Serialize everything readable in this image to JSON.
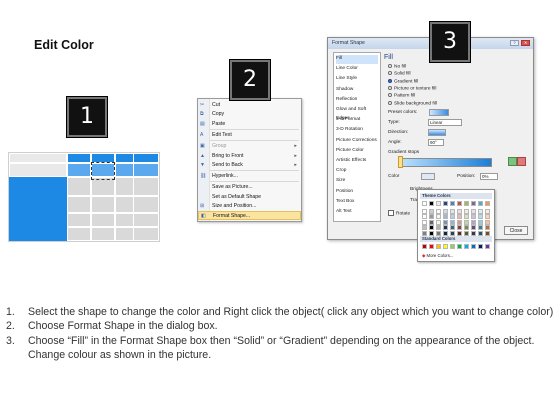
{
  "title": "Edit Color",
  "steps": [
    "1",
    "2",
    "3"
  ],
  "table_shape": {
    "header_color": "#1e88e5",
    "column_color": "#1e88e5",
    "cell_color": "#d9d9d9"
  },
  "context_menu": {
    "items": [
      {
        "label": "Cut",
        "icon": "scissors-icon",
        "disabled": false,
        "arrow": false
      },
      {
        "label": "Copy",
        "icon": "copy-icon",
        "disabled": false,
        "arrow": false
      },
      {
        "label": "Paste",
        "icon": "paste-icon",
        "disabled": false,
        "arrow": false
      },
      {
        "label": "Edit Text",
        "icon": "text-icon",
        "disabled": false,
        "arrow": false
      },
      {
        "label": "Group",
        "icon": "group-icon",
        "disabled": true,
        "arrow": true
      },
      {
        "label": "Bring to Front",
        "icon": "bring-front-icon",
        "disabled": false,
        "arrow": true
      },
      {
        "label": "Send to Back",
        "icon": "send-back-icon",
        "disabled": false,
        "arrow": true
      },
      {
        "label": "Hyperlink...",
        "icon": "link-icon",
        "disabled": false,
        "arrow": false
      },
      {
        "label": "Save as Picture...",
        "icon": "",
        "disabled": false,
        "arrow": false
      },
      {
        "label": "Set as Default Shape",
        "icon": "",
        "disabled": false,
        "arrow": false
      },
      {
        "label": "Size and Position...",
        "icon": "size-icon",
        "disabled": false,
        "arrow": false
      },
      {
        "label": "Format Shape...",
        "icon": "format-icon",
        "disabled": false,
        "arrow": false,
        "highlighted": true
      }
    ]
  },
  "dialog": {
    "title": "Format Shape",
    "categories": [
      "Fill",
      "Line Color",
      "Line Style",
      "Shadow",
      "Reflection",
      "Glow and Soft Edges",
      "3-D Format",
      "3-D Rotation",
      "Picture Corrections",
      "Picture Color",
      "Artistic Effects",
      "Crop",
      "Size",
      "Position",
      "Text Box",
      "Alt Text"
    ],
    "selected_category": "Fill",
    "section_title": "Fill",
    "fill_options": [
      {
        "label": "No fill",
        "checked": false
      },
      {
        "label": "Solid fill",
        "checked": false
      },
      {
        "label": "Gradient fill",
        "checked": true
      },
      {
        "label": "Picture or texture fill",
        "checked": false
      },
      {
        "label": "Pattern fill",
        "checked": false
      },
      {
        "label": "Slide background fill",
        "checked": false
      }
    ],
    "preset_colors_label": "Preset colors:",
    "type_label": "Type:",
    "type_value": "Linear",
    "direction_label": "Direction:",
    "angle_label": "Angle:",
    "angle_value": "90°",
    "gradient_stops_label": "Gradient stops",
    "color_label": "Color",
    "position_label": "Position:",
    "position_value": "0%",
    "brightness_label": "Brightness",
    "transparency_label": "Transparency",
    "rotate_label": "Rotate",
    "close_label": "Close"
  },
  "color_picker": {
    "theme_label": "Theme Colors",
    "standard_label": "Standard Colors",
    "more_label": "More Colors...",
    "theme_top": [
      "#ffffff",
      "#000000",
      "#eeece1",
      "#1f497d",
      "#4f81bd",
      "#c0504d",
      "#9bbb59",
      "#8064a2",
      "#4bacc6",
      "#f79646"
    ],
    "standard": [
      "#c00000",
      "#ff0000",
      "#ffc000",
      "#ffff00",
      "#92d050",
      "#00b050",
      "#00b0f0",
      "#0070c0",
      "#002060",
      "#7030a0"
    ]
  },
  "instructions": [
    {
      "num": "1.",
      "text": "Select the shape to change the color and Right click the object( click any object which you want to change color)"
    },
    {
      "num": "2.",
      "text": "Choose Format Shape in the dialog box."
    },
    {
      "num": "3.",
      "text": "Choose “Fill” in the Format Shape box then “Solid” or “Gradient” depending on the appearance of the object. Change colour as shown in the picture."
    }
  ]
}
